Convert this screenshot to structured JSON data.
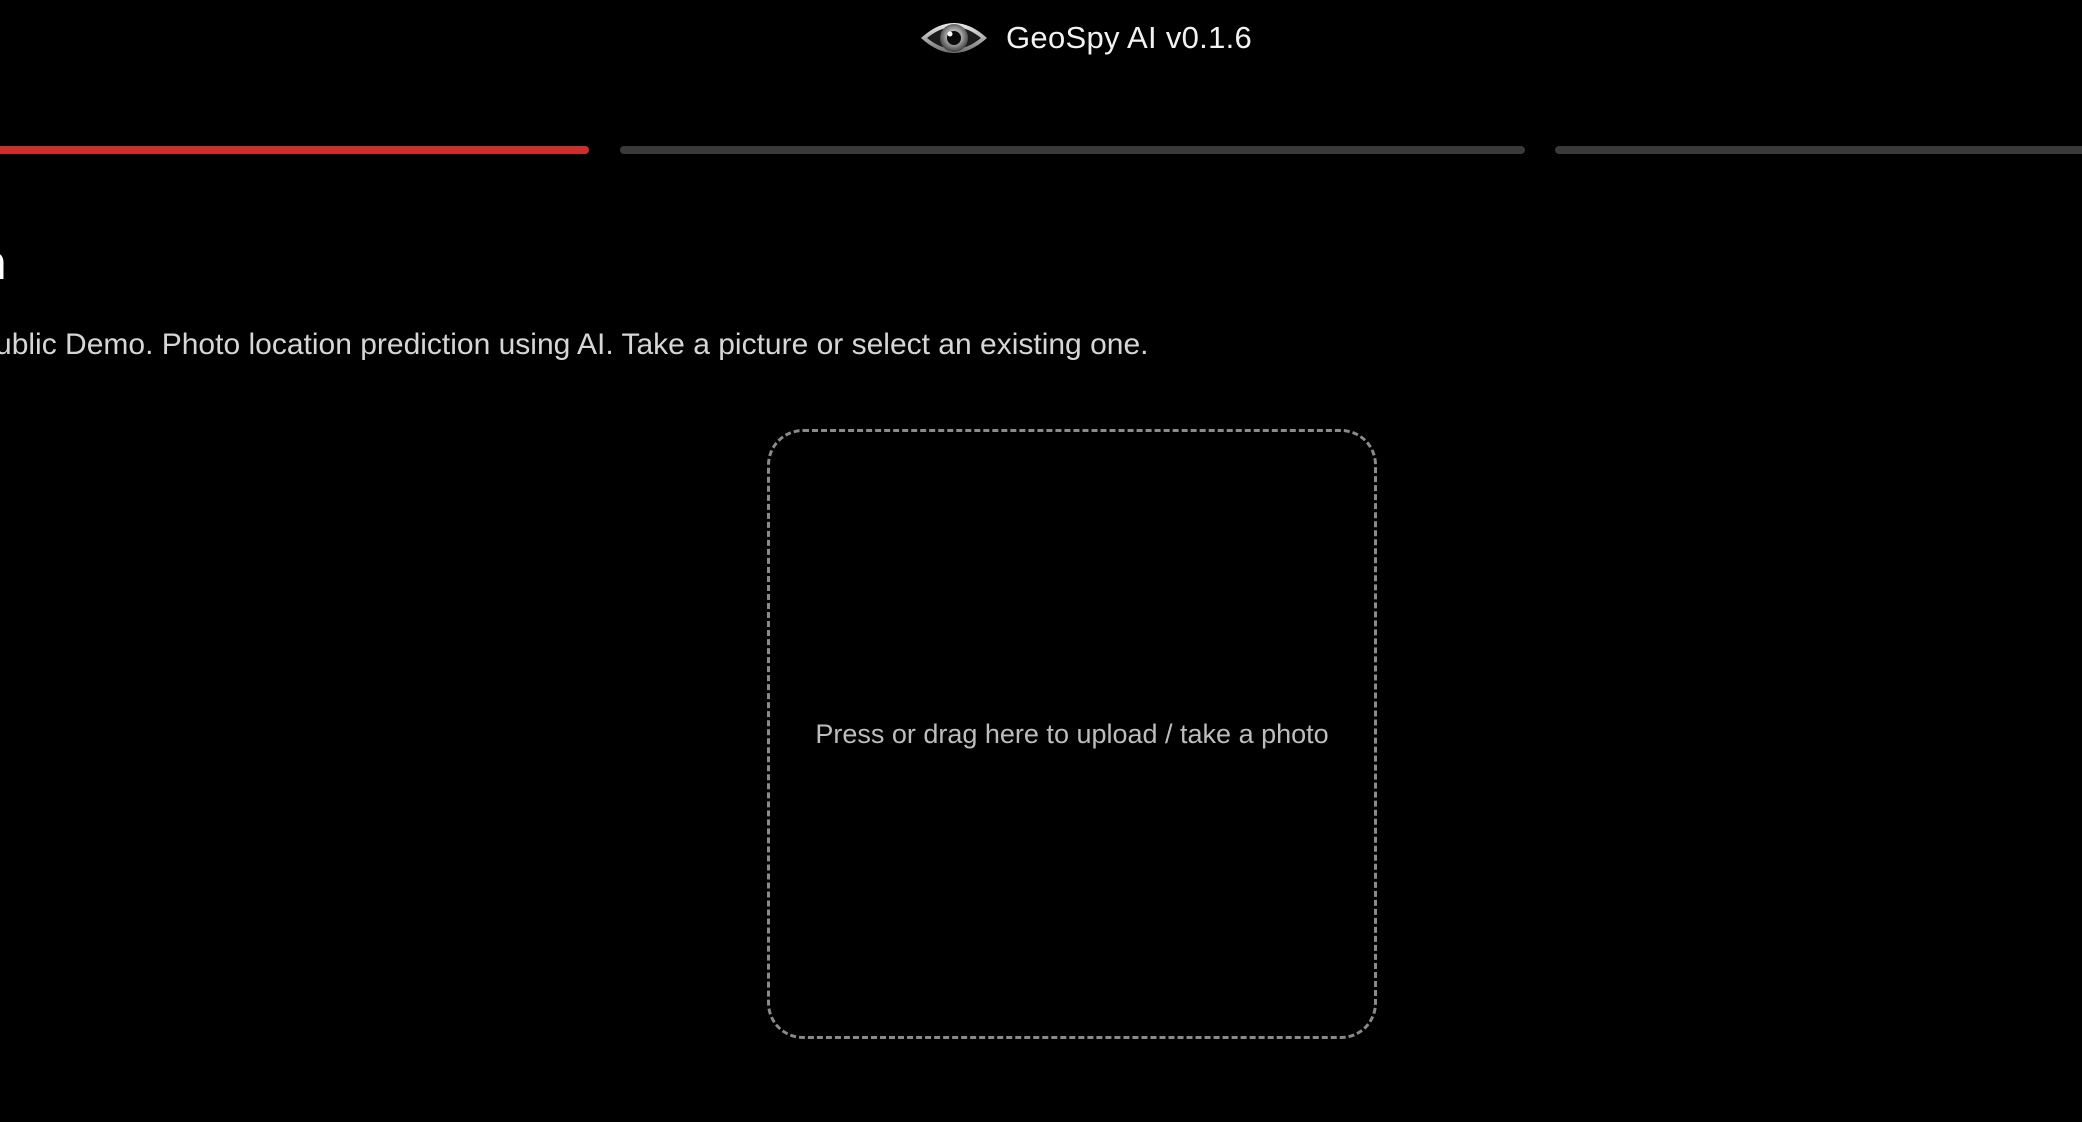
{
  "header": {
    "title": "GeoSpy AI v0.1.6",
    "logo_icon": "eye-icon"
  },
  "stepper": {
    "steps": [
      {
        "state": "active",
        "color": "#c9302c"
      },
      {
        "state": "inactive",
        "color": "#3a3a3a"
      },
      {
        "state": "inactive",
        "color": "#3a3a3a"
      }
    ]
  },
  "main": {
    "title": "arch",
    "subtitle": "Public Demo. Photo location prediction using AI. Take a picture or select an existing one."
  },
  "upload": {
    "label": "Press or drag here to upload / take a photo"
  },
  "colors": {
    "background": "#000000",
    "accent": "#c9302c",
    "muted": "#3a3a3a"
  }
}
